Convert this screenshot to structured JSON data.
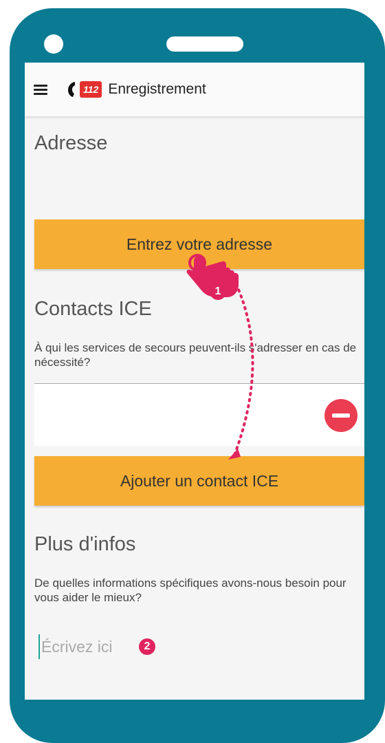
{
  "appbar": {
    "title": "Enregistrement",
    "logo_number": "112",
    "menu_icon": "hamburger-menu-icon",
    "logo_icon": "phone-handset-icon"
  },
  "address": {
    "title": "Adresse",
    "button_label": "Entrez votre adresse"
  },
  "ice": {
    "title": "Contacts ICE",
    "description": "À qui les services de secours peuvent-ils s'adresser en cas de nécessité?",
    "contact_value": "",
    "remove_icon": "minus-circle-icon",
    "add_button_label": "Ajouter un contact ICE"
  },
  "more_info": {
    "title": "Plus d'infos",
    "description": "De quelles informations spécifiques avons-nous besoin pour vous aider le mieux?",
    "placeholder": "Écrivez ici",
    "value": ""
  },
  "annotations": {
    "step1": "1",
    "step2": "2",
    "pointer_icon": "tap-hand-icon",
    "arrow_icon": "dotted-arrow-icon"
  },
  "colors": {
    "frame": "#0a7b93",
    "button": "#f6ad33",
    "accent_pink": "#e0245f",
    "remove_red": "#ea3d51",
    "logo_red": "#e4312f"
  }
}
